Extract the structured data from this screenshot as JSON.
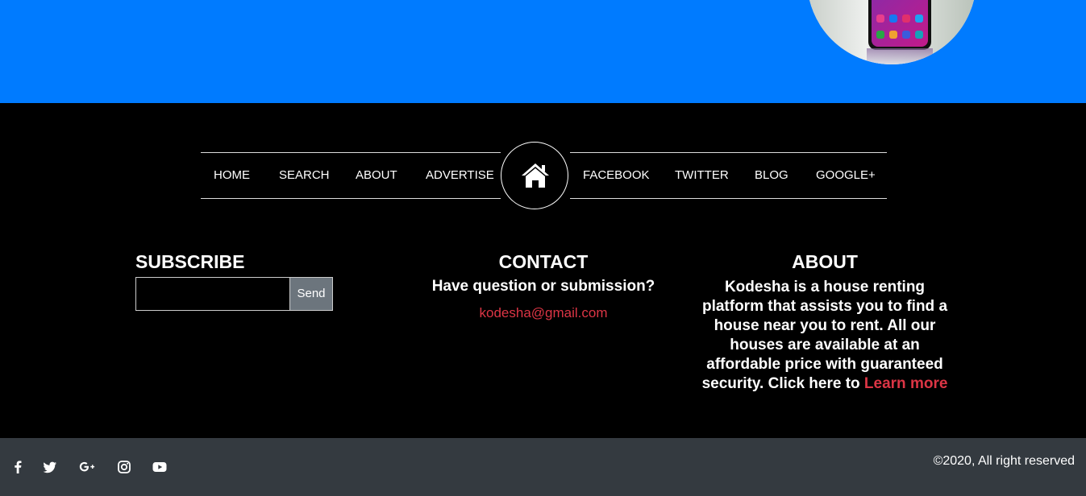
{
  "nav": {
    "left": [
      "HOME",
      "SEARCH",
      "ABOUT",
      "ADVERTISE"
    ],
    "right": [
      "FACEBOOK",
      "TWITTER",
      "BLOG",
      "GOOGLE+"
    ],
    "center_icon": "home-icon"
  },
  "subscribe": {
    "title": "SUBSCRIBE",
    "input_value": "",
    "button_label": "Send"
  },
  "contact": {
    "title": "CONTACT",
    "question": "Have question or submission?",
    "email": "kodesha@gmail.com"
  },
  "about": {
    "title": "ABOUT",
    "text": "Kodesha is a house renting platform that assists you to find a house near you to rent. All our houses are available at an affordable price with guaranteed security. Click here to ",
    "link": "Learn more"
  },
  "social_icons": [
    "facebook-icon",
    "twitter-icon",
    "google-plus-icon",
    "instagram-icon",
    "youtube-icon"
  ],
  "copyright": "©2020, All right reserved",
  "colors": {
    "hero_bg": "#007bff",
    "footer_bg": "#000000",
    "bottom_bar_bg": "#343a40",
    "link_red": "#dc3545",
    "button_gray": "#6c757d"
  }
}
